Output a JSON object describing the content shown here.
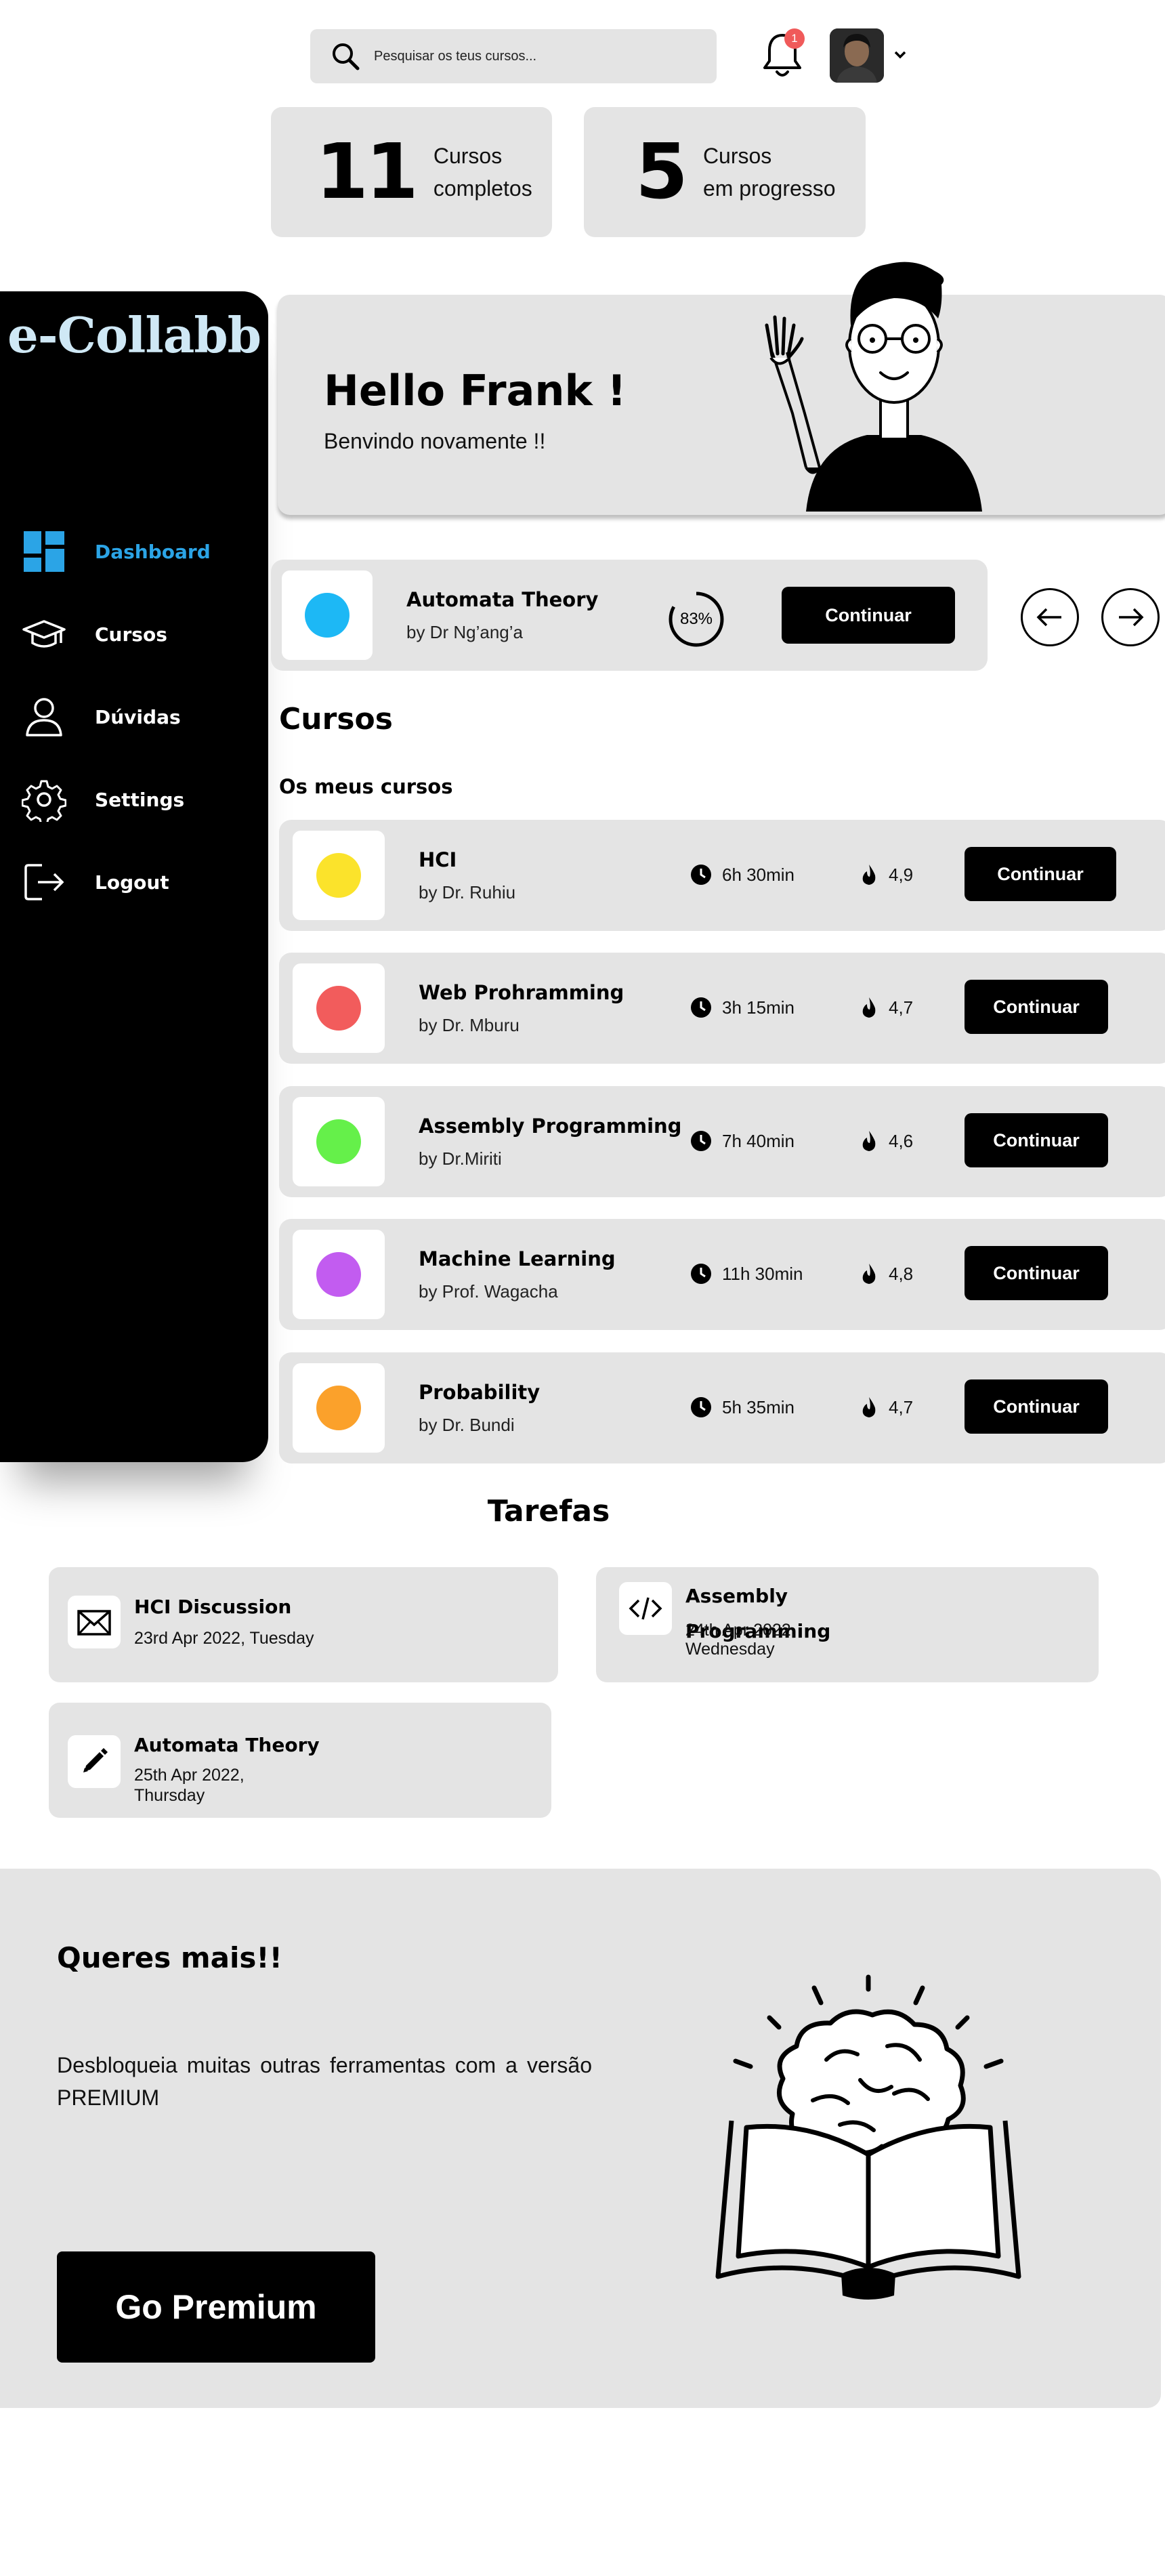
{
  "header": {
    "search_placeholder": "Pesquisar os teus cursos...",
    "notification_count": "1"
  },
  "stats": [
    {
      "value": "11",
      "line1": "Cursos",
      "line2": "completos"
    },
    {
      "value": "5",
      "line1": "Cursos",
      "line2": "em progresso"
    }
  ],
  "sidebar": {
    "logo": "e-Collabb",
    "items": [
      {
        "label": "Dashboard",
        "icon": "dashboard-icon",
        "active": true
      },
      {
        "label": "Cursos",
        "icon": "graduation-cap-icon"
      },
      {
        "label": "Dúvidas",
        "icon": "user-icon"
      },
      {
        "label": "Settings",
        "icon": "gear-icon"
      },
      {
        "label": "Logout",
        "icon": "logout-icon"
      }
    ],
    "active_color": "#2ba4e6"
  },
  "hello": {
    "title": "Hello Frank !",
    "subtitle": "Benvindo novamente !!"
  },
  "current_course": {
    "title": "Automata Theory",
    "by": "by  Dr  Ng’ang’a",
    "progress_label": "83%",
    "progress": 0.83,
    "color": "#1db8f5",
    "button": "Continuar"
  },
  "courses": {
    "title": "Cursos",
    "subtitle": "Os meus cursos",
    "items": [
      {
        "title": "HCI",
        "by": "by Dr. Ruhiu",
        "duration": "6h 30min",
        "rating": "4,9",
        "color": "#fbe32b",
        "button": "Continuar"
      },
      {
        "title": "Web Prohramming",
        "by": "by Dr. Mburu",
        "duration": "3h 15min",
        "rating": "4,7",
        "color": "#f25c5c",
        "button": "Continuar"
      },
      {
        "title": "Assembly Programming",
        "by": "by  Dr.Miriti",
        "duration": "7h 40min",
        "rating": "4,6",
        "color": "#65f04a",
        "button": "Continuar"
      },
      {
        "title": "Machine Learning",
        "by": "by Prof. Wagacha",
        "duration": "11h 30min",
        "rating": "4,8",
        "color": "#c25cf0",
        "button": "Continuar"
      },
      {
        "title": "Probability",
        "by": "by Dr. Bundi",
        "duration": "5h 35min",
        "rating": "4,7",
        "color": "#fba12b",
        "button": "Continuar"
      }
    ]
  },
  "tasks": {
    "title": "Tarefas",
    "items": [
      {
        "title": "HCI Discussion",
        "date": "23rd Apr 2022, Tuesday",
        "icon": "mail-icon"
      },
      {
        "title_line1": "Assembly",
        "title_line2": "Programming",
        "date_line1": "24th Apr 2022,",
        "date_line2": "Wednesday",
        "icon": "code-icon"
      },
      {
        "title": "Automata Theory",
        "date_line1": "25th Apr 2022,",
        "date_line2": "Thursday",
        "icon": "pencil-icon"
      }
    ]
  },
  "premium": {
    "title": "Queres mais!!",
    "text": "Desbloqueia muitas outras ferramentas com a versão PREMIUM",
    "button": "Go Premium"
  }
}
